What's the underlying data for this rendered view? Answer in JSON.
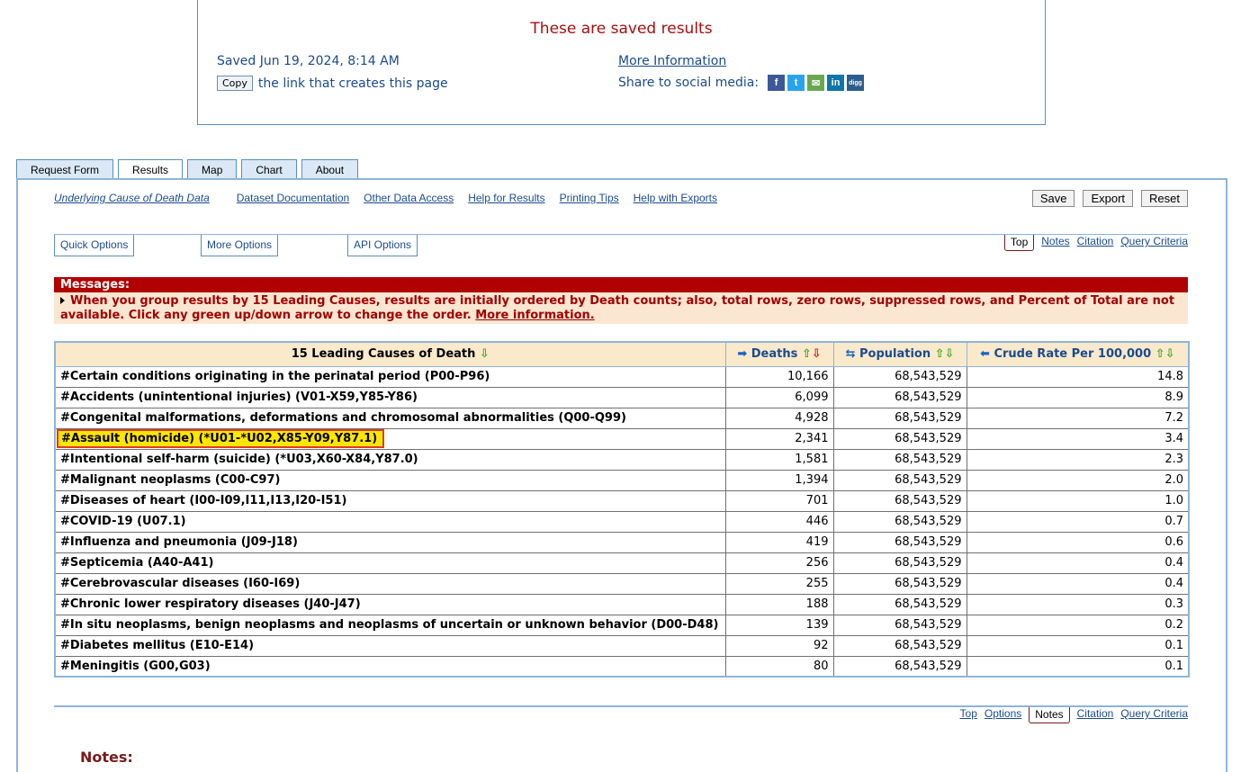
{
  "saved": {
    "title": "These are saved results",
    "date": "Saved Jun 19, 2024, 8:14 AM",
    "copy_label": "Copy",
    "copy_text": "the link that creates this page",
    "more_info": "More Information",
    "share_label": "Share to social media:",
    "social": [
      {
        "glyph": "f",
        "icon": "facebook-icon"
      },
      {
        "glyph": "t",
        "icon": "twitter-icon"
      },
      {
        "glyph": "✉",
        "icon": "email-icon"
      },
      {
        "glyph": "in",
        "icon": "linkedin-icon"
      },
      {
        "glyph": "digg",
        "icon": "digg-icon"
      }
    ]
  },
  "tabs": [
    "Request Form",
    "Results",
    "Map",
    "Chart",
    "About"
  ],
  "toplinks": [
    "Underlying Cause of Death Data",
    "Dataset Documentation",
    "Other Data Access",
    "Help for Results",
    "Printing Tips",
    "Help with Exports"
  ],
  "actions": {
    "save": "Save",
    "export": "Export",
    "reset": "Reset"
  },
  "options": {
    "quick": "Quick Options",
    "more": "More Options",
    "api": "API Options"
  },
  "nav": {
    "top": "Top",
    "notes": "Notes",
    "citation": "Citation",
    "query": "Query Criteria",
    "options": "Options"
  },
  "messages": {
    "header": "Messages:",
    "body": "When you group results by 15 Leading Causes, results are initially ordered by Death counts; also, total rows, zero rows, suppressed rows, and Percent of Total are not available. Click any green up/down arrow to change the order.",
    "link": "More information."
  },
  "table": {
    "headers": [
      "15 Leading Causes of Death",
      "Deaths",
      "Population",
      "Crude Rate Per 100,000"
    ],
    "rows": [
      {
        "cause": "#Certain conditions originating in the perinatal period (P00-P96)",
        "deaths": "10,166",
        "population": "68,543,529",
        "rate": "14.8"
      },
      {
        "cause": "#Accidents (unintentional injuries) (V01-X59,Y85-Y86)",
        "deaths": "6,099",
        "population": "68,543,529",
        "rate": "8.9"
      },
      {
        "cause": "#Congenital malformations, deformations and chromosomal abnormalities (Q00-Q99)",
        "deaths": "4,928",
        "population": "68,543,529",
        "rate": "7.2"
      },
      {
        "cause": "#Assault (homicide) (*U01-*U02,X85-Y09,Y87.1)",
        "deaths": "2,341",
        "population": "68,543,529",
        "rate": "3.4"
      },
      {
        "cause": "#Intentional self-harm (suicide) (*U03,X60-X84,Y87.0)",
        "deaths": "1,581",
        "population": "68,543,529",
        "rate": "2.3"
      },
      {
        "cause": "#Malignant neoplasms (C00-C97)",
        "deaths": "1,394",
        "population": "68,543,529",
        "rate": "2.0"
      },
      {
        "cause": "#Diseases of heart (I00-I09,I11,I13,I20-I51)",
        "deaths": "701",
        "population": "68,543,529",
        "rate": "1.0"
      },
      {
        "cause": "#COVID-19 (U07.1)",
        "deaths": "446",
        "population": "68,543,529",
        "rate": "0.7"
      },
      {
        "cause": "#Influenza and pneumonia (J09-J18)",
        "deaths": "419",
        "population": "68,543,529",
        "rate": "0.6"
      },
      {
        "cause": "#Septicemia (A40-A41)",
        "deaths": "256",
        "population": "68,543,529",
        "rate": "0.4"
      },
      {
        "cause": "#Cerebrovascular diseases (I60-I69)",
        "deaths": "255",
        "population": "68,543,529",
        "rate": "0.4"
      },
      {
        "cause": "#Chronic lower respiratory diseases (J40-J47)",
        "deaths": "188",
        "population": "68,543,529",
        "rate": "0.3"
      },
      {
        "cause": "#In situ neoplasms, benign neoplasms and neoplasms of uncertain or unknown behavior (D00-D48)",
        "deaths": "139",
        "population": "68,543,529",
        "rate": "0.2"
      },
      {
        "cause": "#Diabetes mellitus (E10-E14)",
        "deaths": "92",
        "population": "68,543,529",
        "rate": "0.1"
      },
      {
        "cause": "#Meningitis (G00,G03)",
        "deaths": "80",
        "population": "68,543,529",
        "rate": "0.1"
      }
    ],
    "highlighted_row": 3
  },
  "notes_title": "Notes:",
  "colors": {
    "accent_red": "#b00000",
    "link_blue": "#1a4b8c",
    "border_blue": "#8fb4d9",
    "highlight_yellow": "#ffe600"
  }
}
